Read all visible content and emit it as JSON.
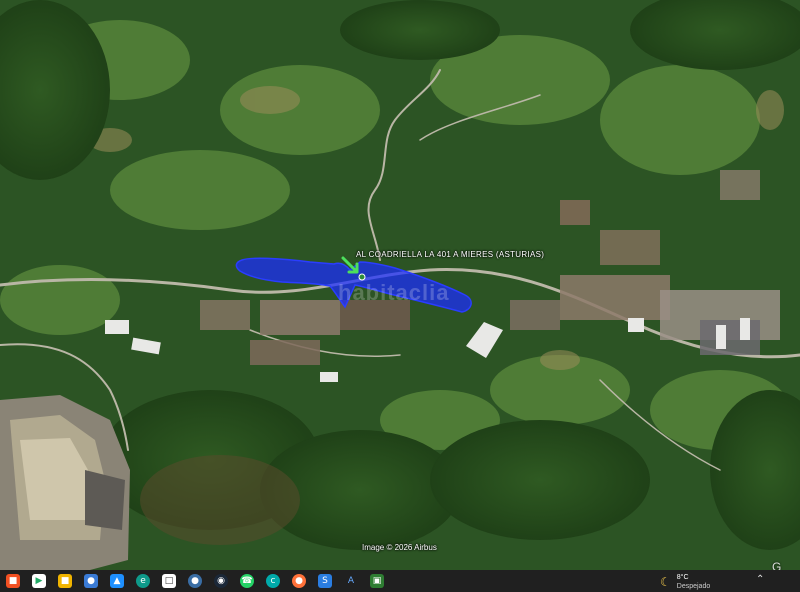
{
  "map": {
    "parcel_label": "AL COADRIELLA LA  401 A MIERES (ASTURIAS)",
    "attribution": "Image © 2026 Airbus",
    "watermark": "habitaclia",
    "google_mark": "G",
    "parcel_fill_color": "#1a2cff",
    "marker_color": "#4cdf5c"
  },
  "taskbar": {
    "icons": [
      "windows-start-icon",
      "app-icon",
      "file-explorer-icon",
      "network-icon",
      "photos-icon",
      "edge-icon",
      "document-icon",
      "python-icon",
      "steam-icon",
      "whatsapp-icon",
      "chat-icon",
      "firefox-icon",
      "app-s-icon",
      "app-a-icon",
      "app-green-icon"
    ],
    "weather": {
      "temperature": "8°C",
      "condition": "Despejado",
      "icon": "moon-icon"
    }
  }
}
